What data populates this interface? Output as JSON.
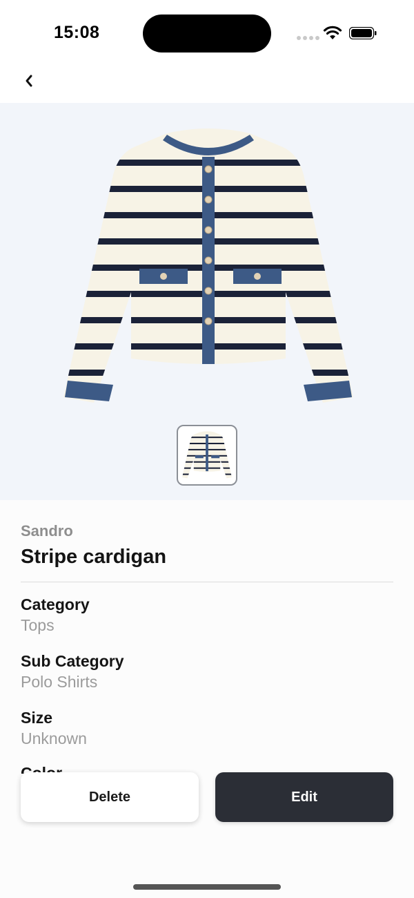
{
  "status": {
    "time": "15:08"
  },
  "product": {
    "brand": "Sandro",
    "name": "Stripe cardigan",
    "image_icon": "cardigan-illustration"
  },
  "fields": [
    {
      "label": "Category",
      "value": "Tops"
    },
    {
      "label": "Sub Category",
      "value": "Polo Shirts"
    },
    {
      "label": "Size",
      "value": "Unknown"
    },
    {
      "label": "Color",
      "value": ""
    }
  ],
  "actions": {
    "delete_label": "Delete",
    "edit_label": "Edit"
  },
  "colors": {
    "panel_bg": "#f2f5fa",
    "edit_bg": "#2b2e36",
    "stripe": "#1b2238",
    "denim": "#3d5a86",
    "knit": "#f7f3e6"
  }
}
